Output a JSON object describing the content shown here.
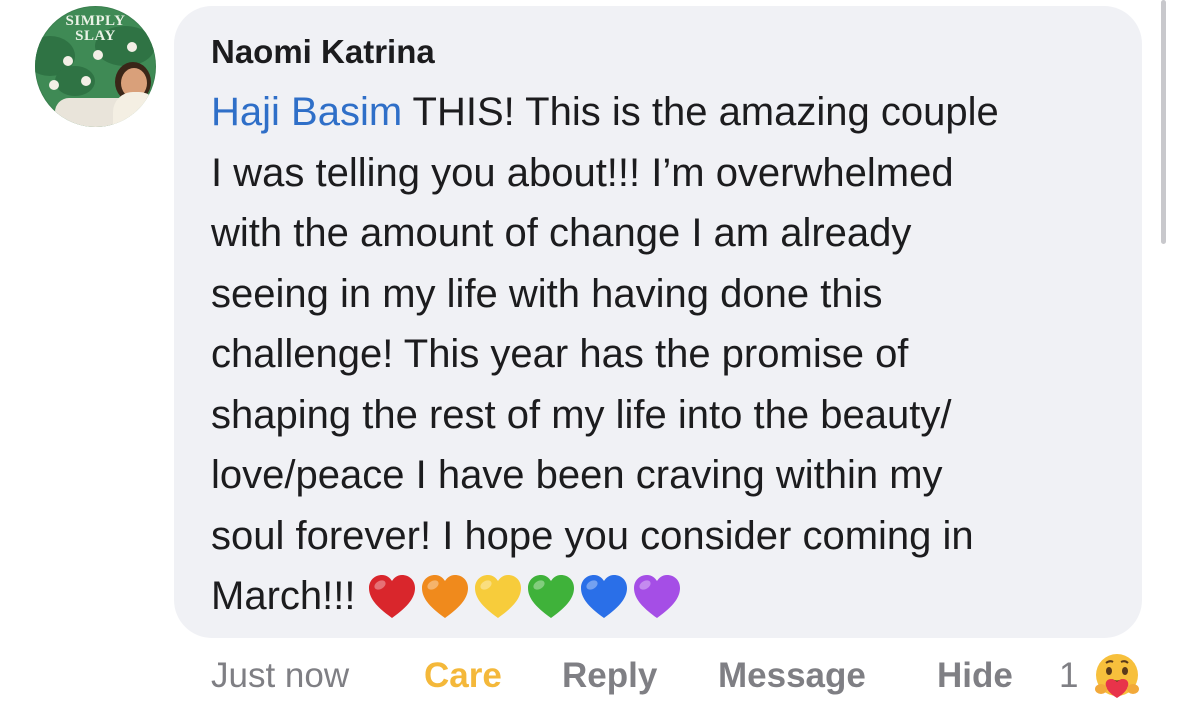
{
  "comment": {
    "author": "Naomi Katrina",
    "avatar_logo_line1": "SIMPLY",
    "avatar_logo_line2": "SLAY",
    "mention": "Haji Basim",
    "lines": [
      " THIS! This is the amazing couple",
      "I was telling you about!!! I’m overwhelmed",
      "with the amount of change I am already",
      "seeing in my life with having done this",
      "challenge! This year has the promise of",
      "shaping the rest of my life into the beauty/",
      "love/peace I have been craving within my",
      "soul forever! I hope you consider coming in",
      "March!!!"
    ],
    "emojis": [
      {
        "name": "red-heart-icon",
        "color": "#d9262c"
      },
      {
        "name": "orange-heart-icon",
        "color": "#f08a1c"
      },
      {
        "name": "yellow-heart-icon",
        "color": "#f7cc3b"
      },
      {
        "name": "green-heart-icon",
        "color": "#3fb23a"
      },
      {
        "name": "blue-heart-icon",
        "color": "#2a6fe8"
      },
      {
        "name": "purple-heart-icon",
        "color": "#a54ee6"
      }
    ]
  },
  "actions": {
    "timestamp": "Just now",
    "care_label": "Care",
    "reply_label": "Reply",
    "message_label": "Message",
    "hide_label": "Hide",
    "reaction_count": "1",
    "reaction_icon": "care-reaction-icon"
  },
  "colors": {
    "bubble": "#f0f1f5",
    "mention": "#2f6fc8",
    "care": "#f4b83a",
    "muted": "#7f7f84"
  }
}
